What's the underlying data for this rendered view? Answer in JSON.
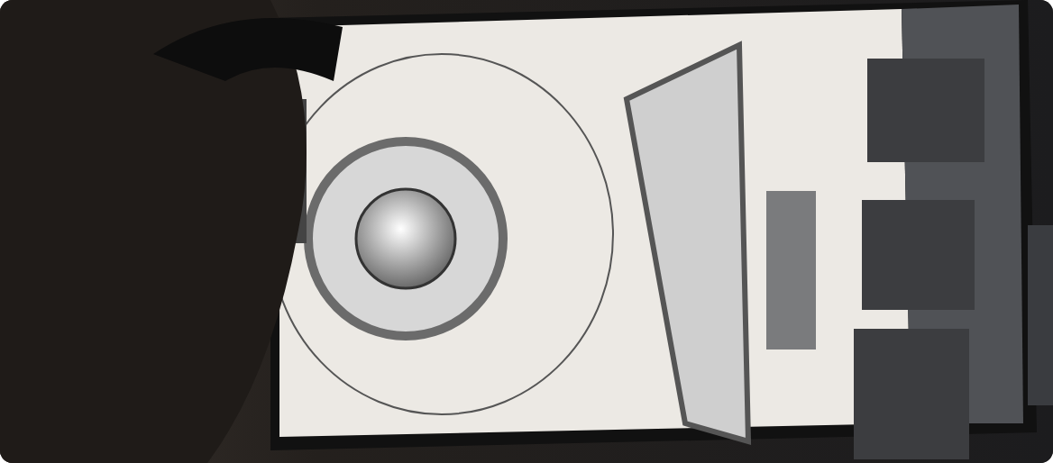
{
  "photo": {
    "kind": "photo"
  }
}
